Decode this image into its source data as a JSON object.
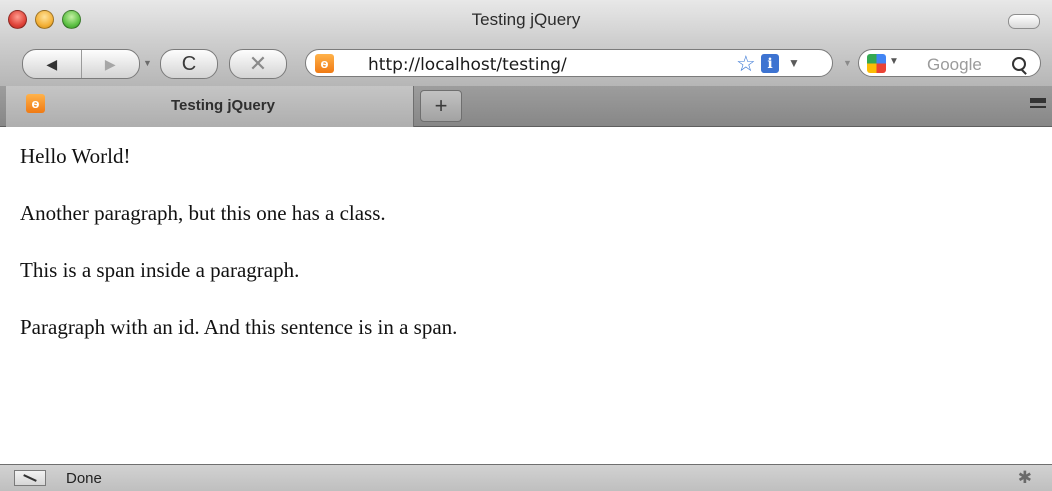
{
  "window": {
    "title": "Testing jQuery"
  },
  "toolbar": {
    "back_icon": "◀",
    "forward_icon": "▶",
    "reload_icon": "C",
    "stop_icon": "✕",
    "url": "http://localhost/testing/",
    "site_badge": "ѳ",
    "search_placeholder": "Google"
  },
  "tabs": [
    {
      "label": "Testing jQuery",
      "active": true
    }
  ],
  "newtab_label": "+",
  "content": {
    "paragraphs": [
      "Hello World!",
      "Another paragraph, but this one has a class.",
      "This is a span inside a paragraph.",
      "Paragraph with an id. And this sentence is in a span."
    ]
  },
  "status": {
    "text": "Done"
  },
  "colors": {
    "site_badge": "#f07a14",
    "bookmark_star": "#3f7bd6",
    "close_light": "#e0443a",
    "minimize_light": "#f4b23a",
    "zoom_light": "#5fc246"
  }
}
